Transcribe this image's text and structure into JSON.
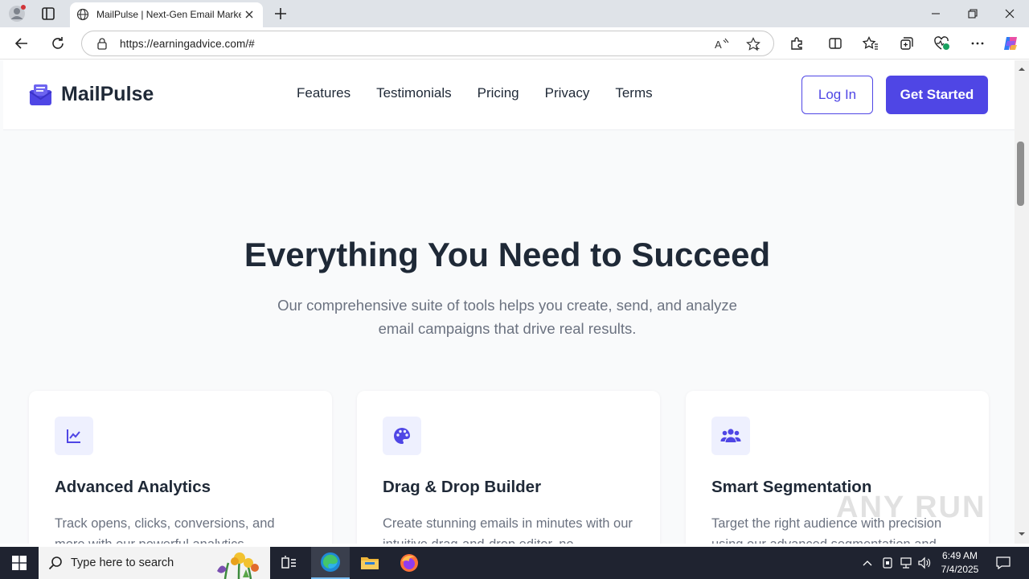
{
  "browser": {
    "tab_title": "MailPulse | Next-Gen Email Marke",
    "url": "https://earningadvice.com/#"
  },
  "nav": {
    "brand": "MailPulse",
    "links": [
      "Features",
      "Testimonials",
      "Pricing",
      "Privacy",
      "Terms"
    ],
    "login": "Log In",
    "get_started": "Get Started"
  },
  "hero": {
    "title": "Everything You Need to Succeed",
    "subtitle": "Our comprehensive suite of tools helps you create, send, and analyze email campaigns that drive real results."
  },
  "features": [
    {
      "icon": "chart-line-icon",
      "title": "Advanced Analytics",
      "desc": "Track opens, clicks, conversions, and more with our powerful analytics"
    },
    {
      "icon": "palette-icon",
      "title": "Drag & Drop Builder",
      "desc": "Create stunning emails in minutes with our intuitive drag-and-drop editor, no"
    },
    {
      "icon": "users-icon",
      "title": "Smart Segmentation",
      "desc": "Target the right audience with precision using our advanced segmentation and"
    }
  ],
  "watermark": "ANY RUN",
  "taskbar": {
    "search_placeholder": "Type here to search",
    "time": "6:49 AM",
    "date": "7/4/2025"
  },
  "colors": {
    "accent": "#4f46e5",
    "heading": "#1f2937",
    "muted": "#6b7280",
    "icon_bg": "#eef0fe"
  }
}
